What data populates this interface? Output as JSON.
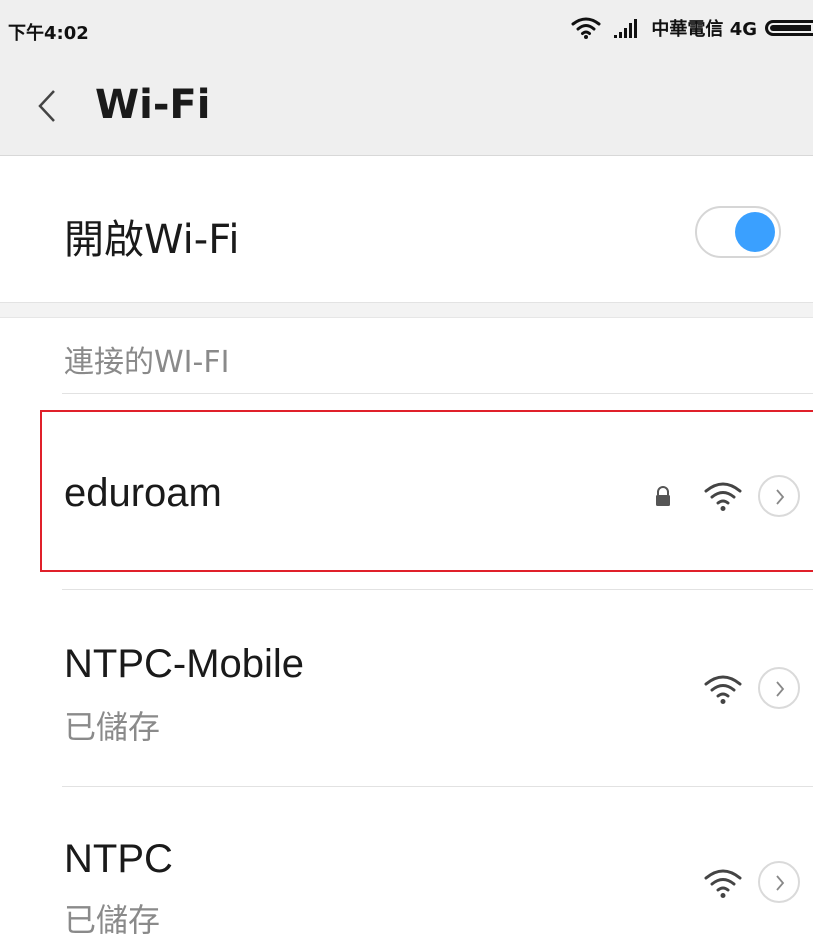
{
  "status_bar": {
    "time": "下午4:02",
    "carrier": "中華電信 4G"
  },
  "header": {
    "title": "Wi-Fi",
    "back_icon": "chevron-left-icon"
  },
  "wifi_toggle": {
    "label": "開啟Wi-Fi",
    "enabled": true,
    "accent_color": "#3aa0ff"
  },
  "section": {
    "title": "連接的WI-FI"
  },
  "networks": [
    {
      "name": "eduroam",
      "subtitle": "",
      "secured": true,
      "highlighted": true
    },
    {
      "name": "NTPC-Mobile",
      "subtitle": "已儲存",
      "secured": false
    },
    {
      "name": "NTPC",
      "subtitle": "已儲存",
      "secured": false
    }
  ],
  "highlight_color": "#e0202a"
}
